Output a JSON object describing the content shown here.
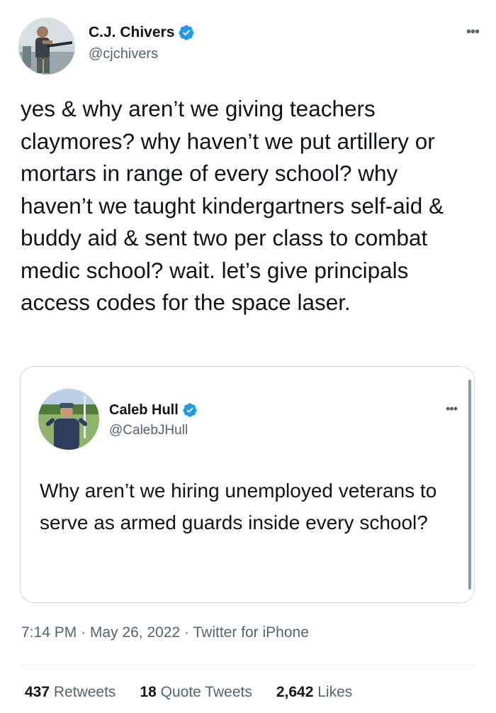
{
  "tweet": {
    "author": {
      "display_name": "C.J. Chivers",
      "handle": "@cjchivers",
      "verified": true,
      "avatar_icon": "profile-photo-man-with-rifle"
    },
    "more_icon": "•••",
    "text": "yes & why aren’t we giving teachers claymores? why haven’t we put artillery or mortars in range of every school? why haven’t we taught kindergartners self-aid & buddy aid & sent two per class to combat medic school?  wait. let’s give principals access codes for the space laser.",
    "quoted": {
      "author": {
        "display_name": "Caleb Hull",
        "handle": "@CalebJHull",
        "verified": true,
        "avatar_icon": "profile-photo-man-in-cap"
      },
      "more_icon": "•••",
      "text": "Why aren’t we hiring unemployed veterans to serve as armed guards inside every school?"
    },
    "meta": {
      "time": "7:14 PM",
      "separator": "·",
      "date": "May 26, 2022",
      "source": "Twitter for iPhone"
    },
    "stats": {
      "retweets_count": "437",
      "retweets_label": "Retweets",
      "quotes_count": "18",
      "quotes_label": "Quote Tweets",
      "likes_count": "2,642",
      "likes_label": "Likes"
    }
  },
  "colors": {
    "text_primary": "#0f1419",
    "text_secondary": "#536471",
    "verified_blue": "#1d9bf0",
    "border": "#cfd9de"
  }
}
